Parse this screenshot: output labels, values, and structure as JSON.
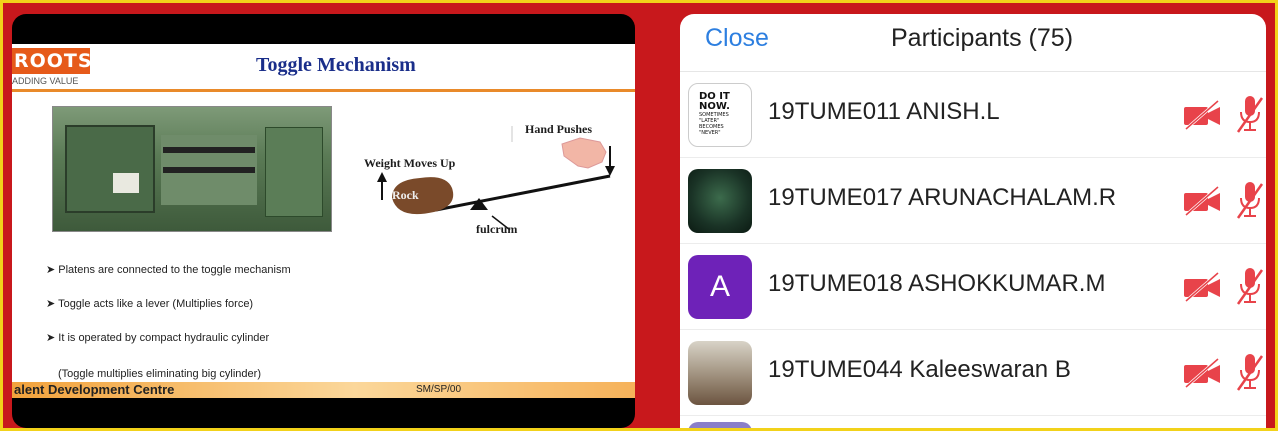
{
  "slide": {
    "logo": "ROOTS",
    "logo_tag": "ADDING VALUE",
    "title": "Toggle Mechanism",
    "labels": {
      "hand": "Hand Pushes",
      "weight": "Weight Moves Up",
      "rock": "Rock",
      "fulcrum": "fulcrum"
    },
    "bullets": [
      "➤  Platens are connected to the toggle mechanism",
      "➤ Toggle acts like a lever (Multiplies force)",
      "➤ It is operated by compact hydraulic cylinder",
      "(Toggle multiplies eliminating big cylinder)"
    ],
    "footer_left": "alent Development Centre",
    "footer_right": "SM/SP/00"
  },
  "panel": {
    "close_label": "Close",
    "title": "Participants (75)"
  },
  "participants": [
    {
      "name": "19TUME011 ANISH.L",
      "avatar_lines": [
        "DO IT",
        "NOW.",
        "SOMETIMES",
        "\"LATER\"",
        "BECOMES",
        "\"NEVER\""
      ]
    },
    {
      "name": "19TUME017 ARUNACHALAM.R"
    },
    {
      "name": "19TUME018 ASHOKKUMAR.M",
      "avatar_letter": "A"
    },
    {
      "name": "19TUME044 Kaleeswaran B"
    }
  ],
  "colors": {
    "background": "#c8181c",
    "border": "#f2d21a",
    "accent_link": "#2d7fe0",
    "muted_red": "#e8434a",
    "avatar_purple": "#6e22b8"
  },
  "icons": {
    "video_off": "video-off-icon",
    "mic_off": "mic-off-icon"
  }
}
